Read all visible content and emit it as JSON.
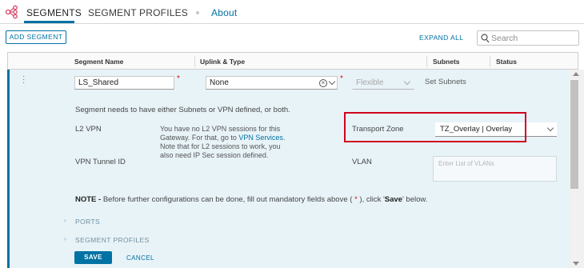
{
  "nav": {
    "tabs": [
      {
        "label": "SEGMENTS",
        "active": true
      },
      {
        "label": "SEGMENT PROFILES",
        "active": false
      }
    ],
    "about": "About",
    "logo_icon": "segments-network-icon"
  },
  "toolbar": {
    "add_segment": "ADD SEGMENT",
    "expand_all": "EXPAND ALL",
    "search_placeholder": "Search"
  },
  "table": {
    "columns": [
      "Segment Name",
      "Uplink & Type",
      "Subnets",
      "Status"
    ]
  },
  "row": {
    "segment_name": "LS_Shared",
    "uplink": "None",
    "type": "Flexible",
    "subnets_link": "Set Subnets",
    "required_mark": "*"
  },
  "details": {
    "message": "Segment needs to have either Subnets or VPN defined, or both.",
    "l2vpn_label": "L2 VPN",
    "l2vpn_desc_1": "You have no L2 VPN sessions for this",
    "l2vpn_desc_2": "Gateway. For that, go to",
    "l2vpn_link": "VPN Services",
    "l2vpn_desc_3": ".",
    "l2vpn_desc_4": "Note that for L2 sessions to work, you",
    "l2vpn_desc_5": "also need IP Sec session defined.",
    "vpn_tunnel_label": "VPN Tunnel ID",
    "transport_zone_label": "Transport Zone",
    "transport_zone_value": "TZ_Overlay | Overlay",
    "vlan_label": "VLAN",
    "vlan_placeholder": "Enter List of VLANs",
    "note_bold": "NOTE -",
    "note_text_1": " Before further configurations can be done, fill out mandatory fields above ( ",
    "note_star": "*",
    "note_text_2": " ), click '",
    "note_save": "Save",
    "note_text_3": "' below.",
    "ports": "PORTS",
    "segment_profiles": "SEGMENT PROFILES",
    "save": "SAVE",
    "cancel": "CANCEL"
  },
  "colors": {
    "accent": "#0072a3",
    "highlight_border": "#d0021b",
    "row_bg": "#e8f3f8",
    "required": "#c21d00"
  }
}
